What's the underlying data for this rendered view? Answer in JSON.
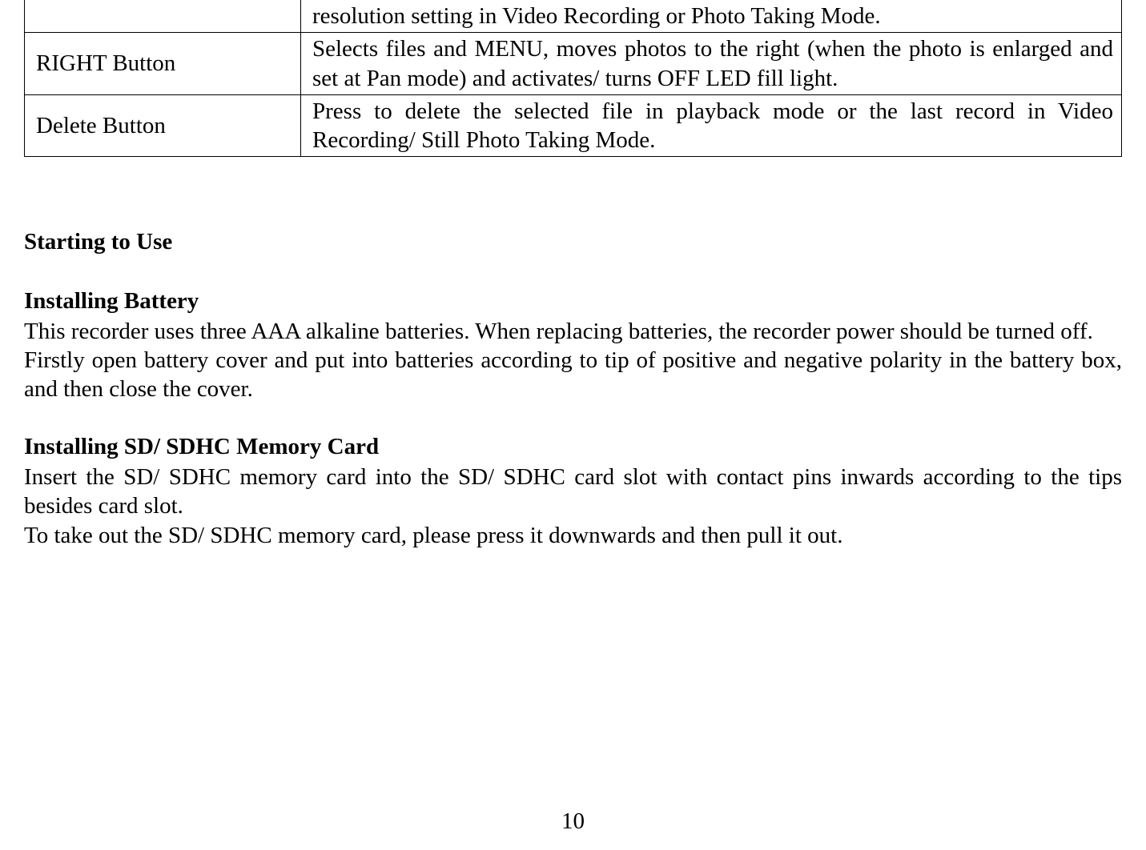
{
  "table": {
    "rows": [
      {
        "label": "",
        "desc": "resolution setting in Video Recording or Photo Taking Mode."
      },
      {
        "label": "RIGHT Button",
        "desc": "Selects files and MENU, moves photos to the right (when the photo is enlarged and set at Pan mode) and activates/ turns OFF LED fill light."
      },
      {
        "label": "Delete Button",
        "desc": "Press to delete the selected file in playback mode or the last record in Video Recording/ Still Photo Taking Mode."
      }
    ]
  },
  "sections": {
    "starting": "Starting to Use",
    "battery": {
      "heading": "Installing Battery",
      "p1": "This recorder uses three AAA alkaline batteries. When replacing batteries, the recorder power should be turned off.",
      "p2": "Firstly open battery cover and put into batteries according to tip of positive and negative polarity in the battery box, and then close the cover."
    },
    "sdcard": {
      "heading": "Installing SD/ SDHC Memory Card",
      "p1": "Insert the SD/ SDHC memory card into the SD/ SDHC card slot with contact pins inwards according to the tips besides card slot.",
      "p2": "To take out the SD/ SDHC memory card, please press it downwards and then pull it out."
    }
  },
  "page_number": "10"
}
